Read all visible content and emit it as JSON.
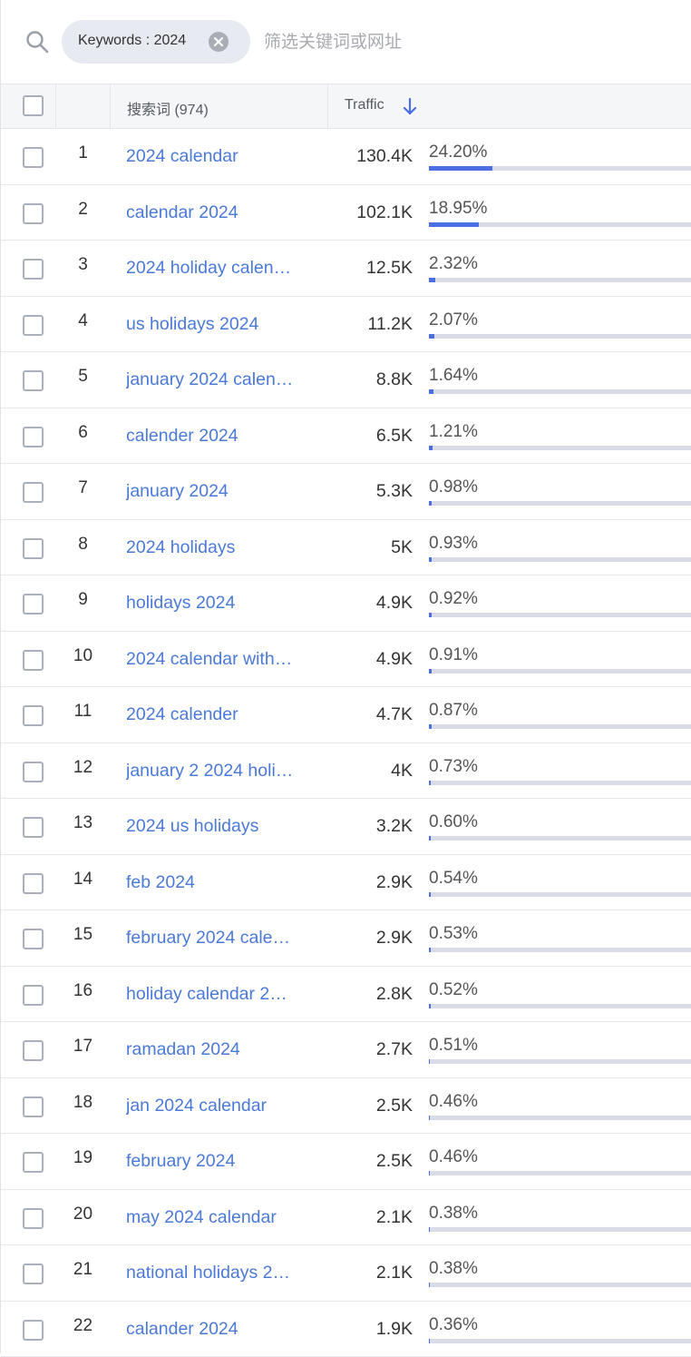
{
  "filter": {
    "icon": "search-icon",
    "chip_label": "Keywords : 2024",
    "chip_clear_icon": "close-circle-icon",
    "placeholder": "筛选关键词或网址"
  },
  "table": {
    "header": {
      "keyword_col": "搜索词 (974)",
      "traffic_col": "Traffic",
      "sort_icon": "arrow-down-icon"
    },
    "colors": {
      "link": "#4a79d8",
      "bar_fill": "#4a6fe3",
      "bar_track": "#d9dce6"
    },
    "rows": [
      {
        "rank": "1",
        "keyword": "2024 calendar",
        "traffic": "130.4K",
        "share": "24.20%",
        "share_value": 24.2
      },
      {
        "rank": "2",
        "keyword": "calendar 2024",
        "traffic": "102.1K",
        "share": "18.95%",
        "share_value": 18.95
      },
      {
        "rank": "3",
        "keyword": "2024 holiday calen…",
        "traffic": "12.5K",
        "share": "2.32%",
        "share_value": 2.32
      },
      {
        "rank": "4",
        "keyword": "us holidays 2024",
        "traffic": "11.2K",
        "share": "2.07%",
        "share_value": 2.07
      },
      {
        "rank": "5",
        "keyword": "january 2024 calen…",
        "traffic": "8.8K",
        "share": "1.64%",
        "share_value": 1.64
      },
      {
        "rank": "6",
        "keyword": "calender 2024",
        "traffic": "6.5K",
        "share": "1.21%",
        "share_value": 1.21
      },
      {
        "rank": "7",
        "keyword": "january 2024",
        "traffic": "5.3K",
        "share": "0.98%",
        "share_value": 0.98
      },
      {
        "rank": "8",
        "keyword": "2024 holidays",
        "traffic": "5K",
        "share": "0.93%",
        "share_value": 0.93
      },
      {
        "rank": "9",
        "keyword": "holidays 2024",
        "traffic": "4.9K",
        "share": "0.92%",
        "share_value": 0.92
      },
      {
        "rank": "10",
        "keyword": "2024 calendar with…",
        "traffic": "4.9K",
        "share": "0.91%",
        "share_value": 0.91
      },
      {
        "rank": "11",
        "keyword": "2024 calender",
        "traffic": "4.7K",
        "share": "0.87%",
        "share_value": 0.87
      },
      {
        "rank": "12",
        "keyword": "january 2 2024 holi…",
        "traffic": "4K",
        "share": "0.73%",
        "share_value": 0.73
      },
      {
        "rank": "13",
        "keyword": "2024 us holidays",
        "traffic": "3.2K",
        "share": "0.60%",
        "share_value": 0.6
      },
      {
        "rank": "14",
        "keyword": "feb 2024",
        "traffic": "2.9K",
        "share": "0.54%",
        "share_value": 0.54
      },
      {
        "rank": "15",
        "keyword": "february 2024 cale…",
        "traffic": "2.9K",
        "share": "0.53%",
        "share_value": 0.53
      },
      {
        "rank": "16",
        "keyword": "holiday calendar 2…",
        "traffic": "2.8K",
        "share": "0.52%",
        "share_value": 0.52
      },
      {
        "rank": "17",
        "keyword": "ramadan 2024",
        "traffic": "2.7K",
        "share": "0.51%",
        "share_value": 0.51
      },
      {
        "rank": "18",
        "keyword": "jan 2024 calendar",
        "traffic": "2.5K",
        "share": "0.46%",
        "share_value": 0.46
      },
      {
        "rank": "19",
        "keyword": "february 2024",
        "traffic": "2.5K",
        "share": "0.46%",
        "share_value": 0.46
      },
      {
        "rank": "20",
        "keyword": "may 2024 calendar",
        "traffic": "2.1K",
        "share": "0.38%",
        "share_value": 0.38
      },
      {
        "rank": "21",
        "keyword": "national holidays 2…",
        "traffic": "2.1K",
        "share": "0.38%",
        "share_value": 0.38
      },
      {
        "rank": "22",
        "keyword": "calander 2024",
        "traffic": "1.9K",
        "share": "0.36%",
        "share_value": 0.36
      }
    ]
  }
}
